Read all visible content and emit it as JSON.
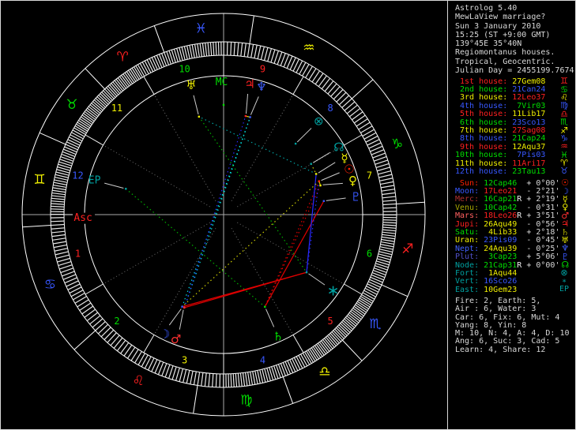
{
  "app": {
    "title_line": "Astrolog 5.40"
  },
  "header": {
    "lines": [
      "Astrolog 5.40",
      "MewLaView marriage?",
      "Sun 3 January 2010",
      "15:25 (ST +9:00 GMT)",
      "139°45E 35°40N",
      "Regiomontanus houses.",
      "Tropical, Geocentric.",
      "Julian Day = 2455199.7674"
    ]
  },
  "palette": {
    "fire": "#ff2020",
    "earth": "#00dd00",
    "air": "#f0f000",
    "water": "#3858ff",
    "white": "#f0f0f0",
    "gray": "#d8d8d8",
    "teal": "#00a0a0",
    "red": "#e00000",
    "blue": "#2828ff",
    "cyan": "#00e0e0",
    "yellow": "#d0d000",
    "green": "#00b000",
    "spoke": "#777777",
    "axis": "#aaaaaa",
    "ring": "#e8e8e8"
  },
  "houses": [
    {
      "label": "1st house:",
      "value": "27Gem08",
      "lon": 87.133,
      "glyph": "♊"
    },
    {
      "label": "2nd house:",
      "value": "21Can24",
      "lon": 111.4,
      "glyph": "♋"
    },
    {
      "label": "3rd house:",
      "value": "12Leo37",
      "lon": 132.617,
      "glyph": "♌"
    },
    {
      "label": "4th house:",
      "value": "7Vir03",
      "lon": 157.05,
      "glyph": "♍"
    },
    {
      "label": "5th house:",
      "value": "11Lib17",
      "lon": 191.283,
      "glyph": "♎"
    },
    {
      "label": "6th house:",
      "value": "23Sco13",
      "lon": 233.217,
      "glyph": "♏"
    },
    {
      "label": "7th house:",
      "value": "27Sag08",
      "lon": 267.133,
      "glyph": "♐"
    },
    {
      "label": "8th house:",
      "value": "21Cap24",
      "lon": 291.4,
      "glyph": "♑"
    },
    {
      "label": "9th house:",
      "value": "12Aqu37",
      "lon": 312.617,
      "glyph": "♒"
    },
    {
      "label": "10th house:",
      "value": "7Pis03",
      "lon": 337.05,
      "glyph": "♓"
    },
    {
      "label": "11th house:",
      "value": "11Ari17",
      "lon": 11.283,
      "glyph": "♈"
    },
    {
      "label": "12th house:",
      "value": "23Tau13",
      "lon": 53.217,
      "glyph": "♉"
    }
  ],
  "house_value_colors": [
    "air",
    "water",
    "fire",
    "earth",
    "air",
    "water",
    "fire",
    "earth",
    "air",
    "water",
    "fire",
    "earth"
  ],
  "element_cycle": [
    "fire",
    "earth",
    "air",
    "water"
  ],
  "signs": [
    {
      "name": "Aries",
      "glyph": "♈",
      "element": "fire"
    },
    {
      "name": "Taurus",
      "glyph": "♉",
      "element": "earth"
    },
    {
      "name": "Gemini",
      "glyph": "♊",
      "element": "air"
    },
    {
      "name": "Cancer",
      "glyph": "♋",
      "element": "water"
    },
    {
      "name": "Leo",
      "glyph": "♌",
      "element": "fire"
    },
    {
      "name": "Virgo",
      "glyph": "♍",
      "element": "earth"
    },
    {
      "name": "Libra",
      "glyph": "♎",
      "element": "air"
    },
    {
      "name": "Scorpio",
      "glyph": "♏",
      "element": "water"
    },
    {
      "name": "Sagittarius",
      "glyph": "♐",
      "element": "fire"
    },
    {
      "name": "Capricorn",
      "glyph": "♑",
      "element": "earth"
    },
    {
      "name": "Aquarius",
      "glyph": "♒",
      "element": "air"
    },
    {
      "name": "Pisces",
      "glyph": "♓",
      "element": "water"
    }
  ],
  "planets": [
    {
      "name": "Sun",
      "label": "Sun:",
      "value": "12Cap46",
      "retro": false,
      "vel": "+ 0°00'",
      "lon": 282.767,
      "glyph": "☉",
      "label_color": "#ff2000",
      "value_color": "earth",
      "sym_color": "#ff2000",
      "wheel_color": "#ff2000"
    },
    {
      "name": "Moon",
      "label": "Moon:",
      "value": "17Leo21",
      "retro": false,
      "vel": "- 2°21'",
      "lon": 137.35,
      "glyph": "☽",
      "label_color": "#3858ff",
      "value_color": "fire",
      "sym_color": "#3858ff",
      "wheel_color": "#3858ff"
    },
    {
      "name": "Merc",
      "label": "Merc:",
      "value": "16Cap21",
      "retro": true,
      "vel": "+ 2°19'",
      "lon": 286.35,
      "glyph": "☿",
      "label_color": "#b03030",
      "value_color": "earth",
      "sym_color": "#f0f000",
      "wheel_color": "#f0f000"
    },
    {
      "name": "Venu",
      "label": "Venu:",
      "value": "10Cap42",
      "retro": false,
      "vel": "- 0°31'",
      "lon": 280.7,
      "glyph": "♀",
      "label_color": "#a8a800",
      "value_color": "earth",
      "sym_color": "#f0f000",
      "wheel_color": "#f0f000"
    },
    {
      "name": "Mars",
      "label": "Mars:",
      "value": "18Leo26",
      "retro": true,
      "vel": "+ 3°51'",
      "lon": 138.433,
      "glyph": "♂",
      "label_color": "#ff6060",
      "value_color": "fire",
      "sym_color": "#ff3030",
      "wheel_color": "#ff3030"
    },
    {
      "name": "Jupi",
      "label": "Jupi:",
      "value": "26Aqu49",
      "retro": false,
      "vel": "- 0°56'",
      "lon": 326.817,
      "glyph": "♃",
      "label_color": "#ff2020",
      "value_color": "air",
      "sym_color": "#ff2020",
      "wheel_color": "#ff2020"
    },
    {
      "name": "Satu",
      "label": "Satu:",
      "value": "4Lib33",
      "retro": false,
      "vel": "+ 2°18'",
      "lon": 184.55,
      "glyph": "♄",
      "label_color": "#00dd00",
      "value_color": "air",
      "sym_color": "#a8a800",
      "wheel_color": "#00dd00"
    },
    {
      "name": "Uran",
      "label": "Uran:",
      "value": "23Pis09",
      "retro": false,
      "vel": "- 0°45'",
      "lon": 353.15,
      "glyph": "♅",
      "label_color": "#f0f000",
      "value_color": "water",
      "sym_color": "#f0f000",
      "wheel_color": "#f0f000"
    },
    {
      "name": "Nept",
      "label": "Nept:",
      "value": "24Aqu39",
      "retro": false,
      "vel": "- 0°25'",
      "lon": 324.65,
      "glyph": "♆",
      "label_color": "#4060ff",
      "value_color": "air",
      "sym_color": "#4060ff",
      "wheel_color": "#4060ff"
    },
    {
      "name": "Plut",
      "label": "Plut:",
      "value": "3Cap23",
      "retro": false,
      "vel": "+ 5°06'",
      "lon": 273.383,
      "glyph": "♇",
      "label_color": "#5050c8",
      "value_color": "earth",
      "sym_color": "#3858ff",
      "wheel_color": "#3858ff"
    },
    {
      "name": "Node",
      "label": "Node:",
      "value": "21Cap31",
      "retro": true,
      "vel": "+ 0°00'",
      "lon": 291.517,
      "glyph": "☊",
      "label_color": "#00a0a0",
      "value_color": "earth",
      "sym_color": "#00dd00",
      "wheel_color": "#00a0a0"
    },
    {
      "name": "Fort",
      "label": "Fort:",
      "value": "1Aqu44",
      "retro": false,
      "vel": "",
      "lon": 301.733,
      "glyph": "⊗",
      "label_color": "#00a0a0",
      "value_color": "air",
      "sym_color": "#00a0a0",
      "wheel_color": "#00a0a0"
    },
    {
      "name": "Vert",
      "label": "Vert:",
      "value": "16Sco26",
      "retro": false,
      "vel": "",
      "lon": 226.433,
      "glyph": "∗",
      "label_color": "#00a0a0",
      "value_color": "water",
      "sym_color": "#00a0a0",
      "wheel_color": "#00a0a0"
    },
    {
      "name": "East",
      "label": "East:",
      "value": "10Gem23",
      "retro": false,
      "vel": "",
      "lon": 70.383,
      "glyph": "EP",
      "label_color": "#00a0a0",
      "value_color": "air",
      "sym_color": "#00a0a0",
      "wheel_color": "#00a0a0"
    }
  ],
  "totals": {
    "lines": [
      "Fire: 2, Earth: 5,",
      "Air : 6, Water: 3",
      "Car: 6, Fix: 6, Mut: 4",
      "Yang: 8, Yin: 8",
      "M: 10, N: 4, A: 4, D: 10",
      "Ang: 6, Suc: 3, Cad: 5",
      "Learn: 4, Share: 12"
    ]
  },
  "wheel": {
    "angle_labels": {
      "asc": "Asc",
      "mc": "MC"
    },
    "house_numbers": [
      "1",
      "2",
      "3",
      "4",
      "5",
      "6",
      "7",
      "8",
      "9",
      "10",
      "11",
      "12"
    ],
    "aspects": [
      {
        "a": "Moon",
        "b": "Vert",
        "color": "red",
        "solid": true
      },
      {
        "a": "Mars",
        "b": "Vert",
        "color": "red",
        "solid": true
      },
      {
        "a": "Satu",
        "b": "Plut",
        "color": "red",
        "solid": true
      },
      {
        "a": "Venu",
        "b": "Satu",
        "color": "red",
        "solid": false
      },
      {
        "a": "Sun",
        "b": "Satu",
        "color": "red",
        "solid": false
      },
      {
        "a": "Merc",
        "b": "Vert",
        "color": "blue",
        "solid": true
      },
      {
        "a": "Sun",
        "b": "Vert",
        "color": "blue",
        "solid": false
      },
      {
        "a": "Mars",
        "b": "Nept",
        "color": "cyan",
        "solid": false
      },
      {
        "a": "Moon",
        "b": "Nept",
        "color": "cyan",
        "solid": false
      },
      {
        "a": "Mars",
        "b": "Jupi",
        "color": "blue",
        "solid": false
      },
      {
        "a": "Sun",
        "b": "Moon",
        "color": "yellow",
        "solid": false
      },
      {
        "a": "Merc",
        "b": "Uran",
        "color": "teal",
        "solid": false
      },
      {
        "a": "East",
        "b": "Satu",
        "color": "green",
        "solid": false
      },
      {
        "a": "Uran",
        "b": "Vert",
        "color": "green",
        "solid": false
      },
      {
        "a": "Jupi",
        "b": "Nept",
        "color": "yellow",
        "solid": true
      },
      {
        "a": "Sun",
        "b": "Venu",
        "color": "yellow",
        "solid": true
      },
      {
        "a": "Node",
        "b": "Merc",
        "color": "yellow",
        "solid": false
      }
    ]
  }
}
